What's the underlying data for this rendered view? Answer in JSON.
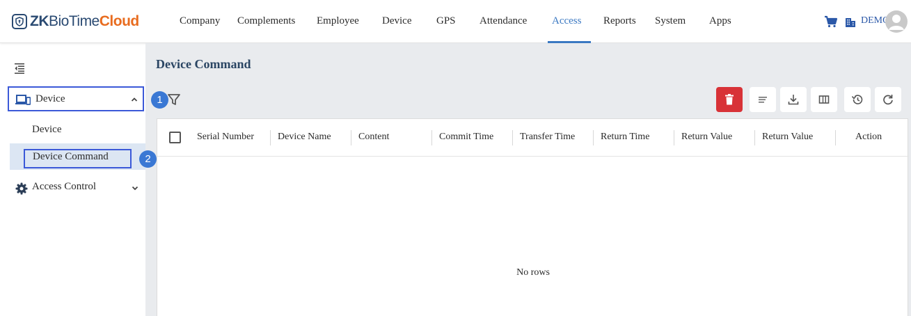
{
  "app": {
    "logo_zk": "ZK",
    "logo_biotime": "BioTime",
    "logo_cloud": "Cloud"
  },
  "nav": {
    "items": [
      {
        "label": "Company"
      },
      {
        "label": "Complements"
      },
      {
        "label": "Employee"
      },
      {
        "label": "Device"
      },
      {
        "label": "GPS"
      },
      {
        "label": "Attendance"
      },
      {
        "label": "Access",
        "active": true
      },
      {
        "label": "Reports"
      },
      {
        "label": "System"
      },
      {
        "label": "Apps"
      }
    ],
    "user_label": "DEMO",
    "icons": [
      "cart-icon",
      "building-icon",
      "avatar-icon"
    ]
  },
  "sidebar": {
    "groups": [
      {
        "label": "Device",
        "icon": "device-icon",
        "expanded": true,
        "items": [
          {
            "label": "Device"
          },
          {
            "label": "Device Command",
            "active": true
          }
        ]
      },
      {
        "label": "Access Control",
        "icon": "gear-icon",
        "expanded": false
      }
    ]
  },
  "badges": {
    "first": "1",
    "second": "2"
  },
  "main": {
    "title": "Device Command",
    "toolbar_icons": [
      "filter-icon",
      "delete-icon",
      "list-icon",
      "download-icon",
      "columns-icon",
      "history-icon",
      "refresh-icon"
    ],
    "columns": [
      {
        "label": "Serial Number"
      },
      {
        "label": "Device Name"
      },
      {
        "label": "Content"
      },
      {
        "label": "Commit Time"
      },
      {
        "label": "Transfer Time"
      },
      {
        "label": "Return Time"
      },
      {
        "label": "Return Value"
      },
      {
        "label": "Return Value"
      },
      {
        "label": "Action"
      }
    ],
    "empty_text": "No rows"
  },
  "colors": {
    "accent": "#3a78c2",
    "delete": "#d83237",
    "highlight_border": "#3b59d8",
    "badge": "#3a78d4"
  }
}
